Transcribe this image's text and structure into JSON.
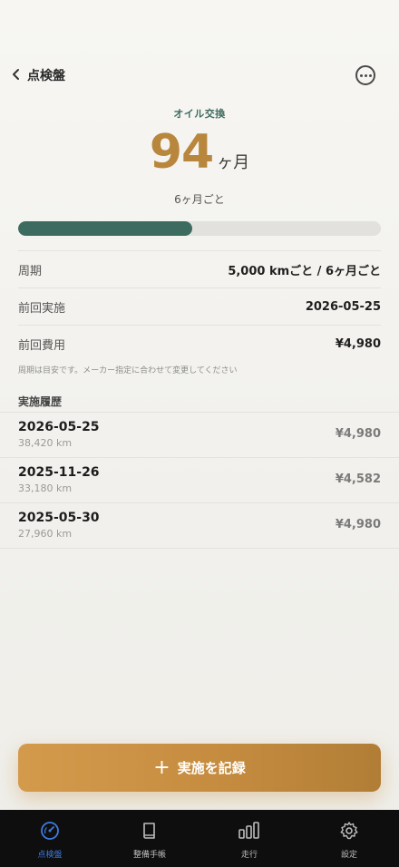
{
  "nav": {
    "back_label": "点検盤"
  },
  "item": {
    "name": "オイル交換",
    "remaining_value": "94",
    "remaining_unit": "ヶ月",
    "interval_text": "6ヶ月ごと",
    "progress": 0.48
  },
  "details": [
    {
      "label": "周期",
      "value": "5,000 kmごと / 6ヶ月ごと"
    },
    {
      "label": "前回実施",
      "value": "2026-05-25"
    },
    {
      "label": "前回費用",
      "value": "¥4,980"
    }
  ],
  "note": "周期は目安です。メーカー指定に合わせて変更してください",
  "history": {
    "title": "実施履歴",
    "items": [
      {
        "date": "2026-05-25",
        "km": "38,420 km",
        "cost": "¥4,980"
      },
      {
        "date": "2025-11-26",
        "km": "33,180 km",
        "cost": "¥4,582"
      },
      {
        "date": "2025-05-30",
        "km": "27,960 km",
        "cost": "¥4,980"
      }
    ]
  },
  "cta": {
    "label": "実施を記録"
  },
  "tabs": [
    {
      "label": "点検盤",
      "icon": "gauge-icon",
      "active": true
    },
    {
      "label": "整備手帳",
      "icon": "book-icon",
      "active": false
    },
    {
      "label": "走行",
      "icon": "bars-icon",
      "active": false
    },
    {
      "label": "設定",
      "icon": "gear-icon",
      "active": false
    }
  ],
  "colors": {
    "accent": "#b8863c",
    "progress": "#3d6b60",
    "tab_active": "#3d7be0"
  }
}
